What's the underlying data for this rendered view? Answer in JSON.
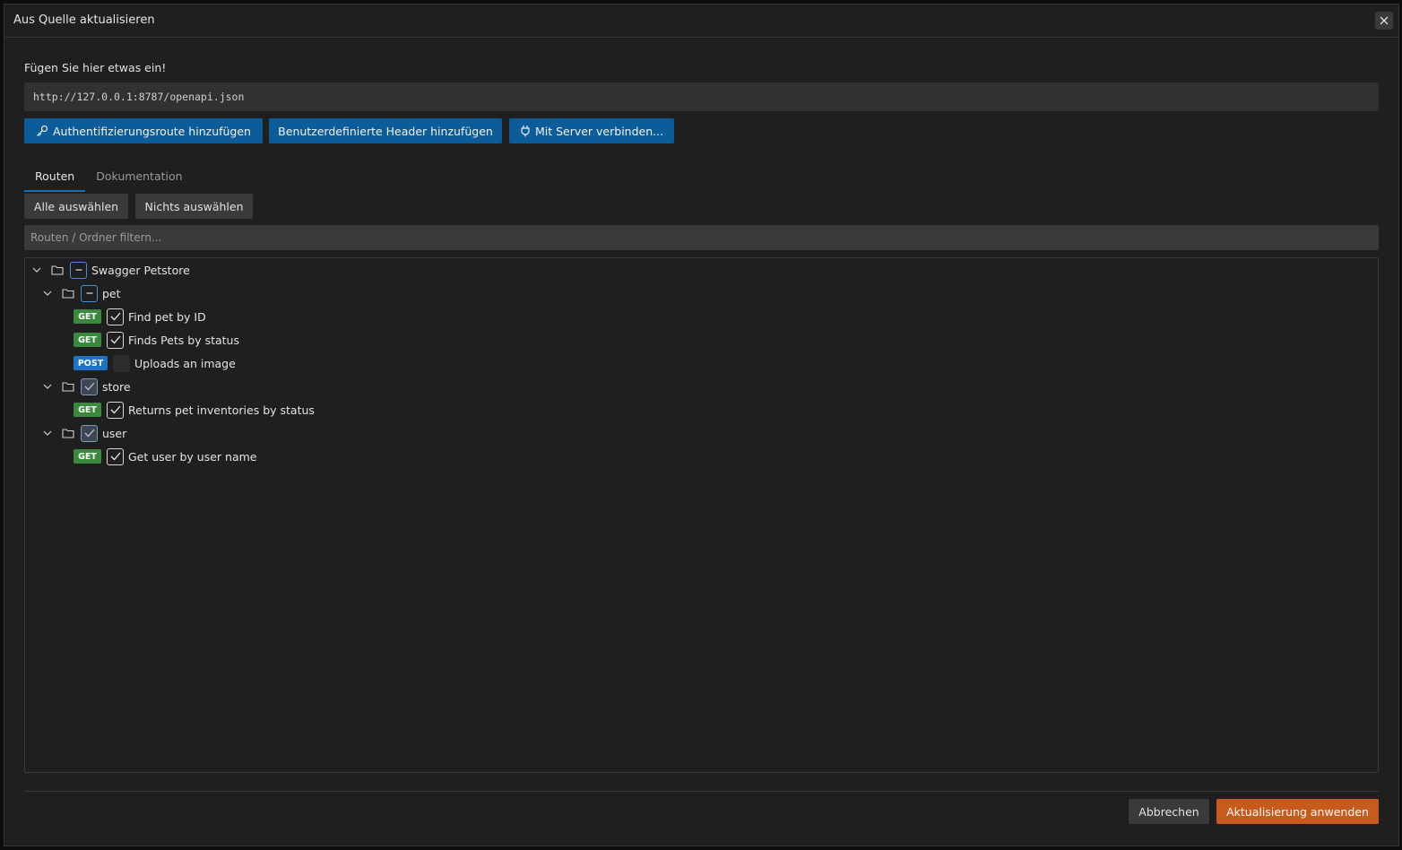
{
  "dialog": {
    "title": "Aus Quelle aktualisieren",
    "close_icon": "close-icon"
  },
  "source": {
    "label": "Fügen Sie hier etwas ein!",
    "url_value": "http://127.0.0.1:8787/openapi.json"
  },
  "actions": {
    "auth_route": "Authentifizierungsroute hinzufügen",
    "custom_header": "Benutzerdefinierte Header hinzufügen",
    "connect_server": "Mit Server verbinden..."
  },
  "tabs": [
    {
      "label": "Routen",
      "active": true
    },
    {
      "label": "Dokumentation",
      "active": false
    }
  ],
  "selection": {
    "select_all": "Alle auswählen",
    "select_none": "Nichts auswählen"
  },
  "filter": {
    "placeholder": "Routen / Ordner filtern..."
  },
  "tree": {
    "root": {
      "label": "Swagger Petstore",
      "state": "partial"
    },
    "folders": [
      {
        "label": "pet",
        "state": "partial",
        "routes": [
          {
            "method": "GET",
            "label": "Find pet by ID",
            "checked": true
          },
          {
            "method": "GET",
            "label": "Finds Pets by status",
            "checked": true
          },
          {
            "method": "POST",
            "label": "Uploads an image",
            "checked": false
          }
        ]
      },
      {
        "label": "store",
        "state": "checked",
        "routes": [
          {
            "method": "GET",
            "label": "Returns pet inventories by status",
            "checked": true
          }
        ]
      },
      {
        "label": "user",
        "state": "checked",
        "routes": [
          {
            "method": "GET",
            "label": "Get user by user name",
            "checked": true
          }
        ]
      }
    ]
  },
  "footer": {
    "cancel": "Abbrechen",
    "apply": "Aktualisierung anwenden"
  },
  "colors": {
    "primary_blue": "#0c5c9a",
    "apply_orange": "#c95a1d",
    "get_green": "#3a8a3e",
    "post_blue": "#1f73c4"
  }
}
